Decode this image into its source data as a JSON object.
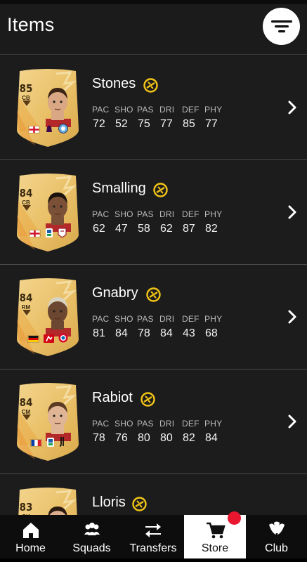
{
  "header": {
    "title": "Items"
  },
  "stat_labels": [
    "PAC",
    "SHO",
    "PAS",
    "DRI",
    "DEF",
    "PHY"
  ],
  "players": [
    {
      "name": "Stones",
      "rating": "85",
      "position": "CB",
      "stats": [
        "72",
        "52",
        "75",
        "77",
        "85",
        "77"
      ],
      "skin": "#d9a784",
      "hair": "#3b2414",
      "flags": [
        "england",
        "premier-league",
        "man-city"
      ]
    },
    {
      "name": "Smalling",
      "rating": "84",
      "position": "CB",
      "stats": [
        "62",
        "47",
        "58",
        "62",
        "87",
        "82"
      ],
      "skin": "#7a5036",
      "hair": "#1a120c",
      "flags": [
        "england",
        "serie-a",
        "roma"
      ]
    },
    {
      "name": "Gnabry",
      "rating": "84",
      "position": "RM",
      "stats": [
        "81",
        "84",
        "78",
        "84",
        "43",
        "68"
      ],
      "skin": "#6b4630",
      "hair": "#d8d2c0",
      "flags": [
        "germany",
        "bundesliga",
        "bayern"
      ]
    },
    {
      "name": "Rabiot",
      "rating": "84",
      "position": "CM",
      "stats": [
        "78",
        "76",
        "80",
        "80",
        "82",
        "84"
      ],
      "skin": "#e0b596",
      "hair": "#5a3a22",
      "flags": [
        "france",
        "serie-a",
        "juventus"
      ]
    },
    {
      "name": "Lloris",
      "rating": "83",
      "position": "GK",
      "stats": [
        "",
        "",
        "",
        "",
        "",
        ""
      ],
      "skin": "#d9ad8e",
      "hair": "#2a1a10",
      "flags": []
    }
  ],
  "nav": [
    {
      "label": "Home",
      "icon": "home-icon"
    },
    {
      "label": "Squads",
      "icon": "squads-icon"
    },
    {
      "label": "Transfers",
      "icon": "transfers-icon"
    },
    {
      "label": "Store",
      "icon": "cart-icon",
      "active": true,
      "notification": true
    },
    {
      "label": "Club",
      "icon": "club-icon"
    }
  ],
  "colors": {
    "accent": "#f2c418",
    "card_gold": "#e8c06a",
    "notification": "#e8162f"
  }
}
